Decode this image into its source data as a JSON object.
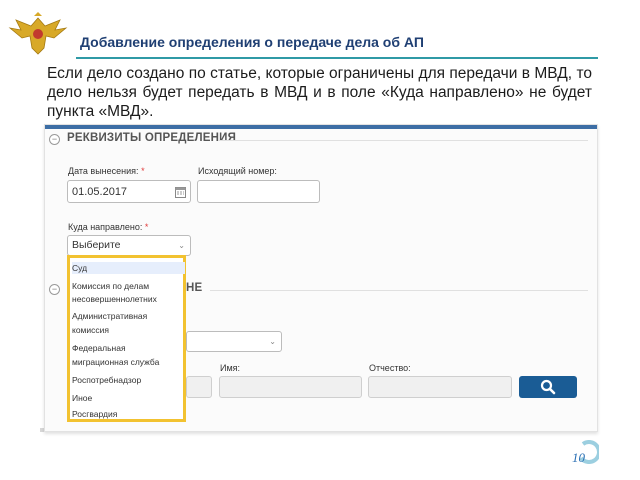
{
  "slide": {
    "title": "Добавление определения о передаче дела об АП",
    "intro": "Если дело создано по статье, которые ограничены для передачи в МВД, то дело нельзя будет передать в МВД и в поле «Куда направлено» не будет пункта «МВД».",
    "page_number": "10"
  },
  "form": {
    "section1_title": "РЕКВИЗИТЫ ОПРЕДЕЛЕНИЯ",
    "date_label": "Дата вынесения:",
    "date_value": "01.05.2017",
    "outgoing_label": "Исходящий номер:",
    "outgoing_value": "",
    "sent_to_label": "Куда направлено:",
    "sent_to_value": "Выберите",
    "required_mark": "*",
    "section2_title_fragment": "НЕ",
    "first_name_label": "Имя:",
    "patronymic_label": "Отчество:"
  },
  "dropdown": {
    "options": [
      "Суд",
      "Комиссия по делам",
      "несовершеннолетних",
      "Административная",
      "комиссия",
      "Федеральная",
      "миграционная служба",
      "Роспотребнадзор",
      "Иное",
      "Росгвардия"
    ],
    "highlighted_index": 0
  },
  "colors": {
    "title_color": "#1f3f73",
    "accent_line": "#2f9aa6",
    "highlight_border": "#f2c230",
    "search_button": "#1a5c95",
    "header_bar": "#3d6ea5"
  },
  "icons": {
    "emblem": "double-headed-eagle-emblem",
    "calendar": "calendar-icon",
    "search": "search-icon",
    "collapse": "collapse-icon"
  }
}
